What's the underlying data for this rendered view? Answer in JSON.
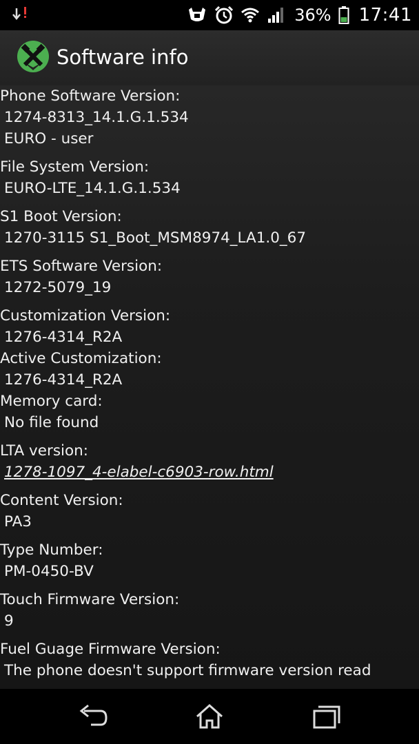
{
  "status_bar": {
    "battery_percent": "36%",
    "time": "17:41",
    "icons": [
      "download-warning-icon",
      "stamina-icon",
      "alarm-icon",
      "wifi-icon",
      "signal-icon",
      "battery-icon"
    ]
  },
  "header": {
    "title": "Software info",
    "icon": "tools-icon"
  },
  "info": {
    "phone_sw": {
      "label": "Phone Software Version:",
      "line1": "1274-8313_14.1.G.1.534",
      "line2": "EURO - user"
    },
    "fs": {
      "label": "File System Version:",
      "value": "EURO-LTE_14.1.G.1.534"
    },
    "s1": {
      "label": "S1 Boot Version:",
      "value": "1270-3115 S1_Boot_MSM8974_LA1.0_67"
    },
    "ets": {
      "label": "ETS Software Version:",
      "value": "1272-5079_19"
    },
    "custom": {
      "label": "Customization Version:",
      "value": "1276-4314_R2A"
    },
    "active_custom": {
      "label": "Active Customization:",
      "value": "1276-4314_R2A"
    },
    "memory": {
      "label": "Memory card:",
      "value": "No file found"
    },
    "lta": {
      "label": "LTA version:",
      "value": "1278-1097_4-elabel-c6903-row.html"
    },
    "content": {
      "label": "Content Version:",
      "value": "PA3"
    },
    "type": {
      "label": "Type Number:",
      "value": "PM-0450-BV"
    },
    "touch": {
      "label": "Touch Firmware Version:",
      "value": "9"
    },
    "fuel": {
      "label": "Fuel Guage Firmware Version:",
      "value": "The phone doesn't support firmware version read"
    }
  },
  "nav": {
    "icons": [
      "back-icon",
      "home-icon",
      "recents-icon"
    ]
  }
}
